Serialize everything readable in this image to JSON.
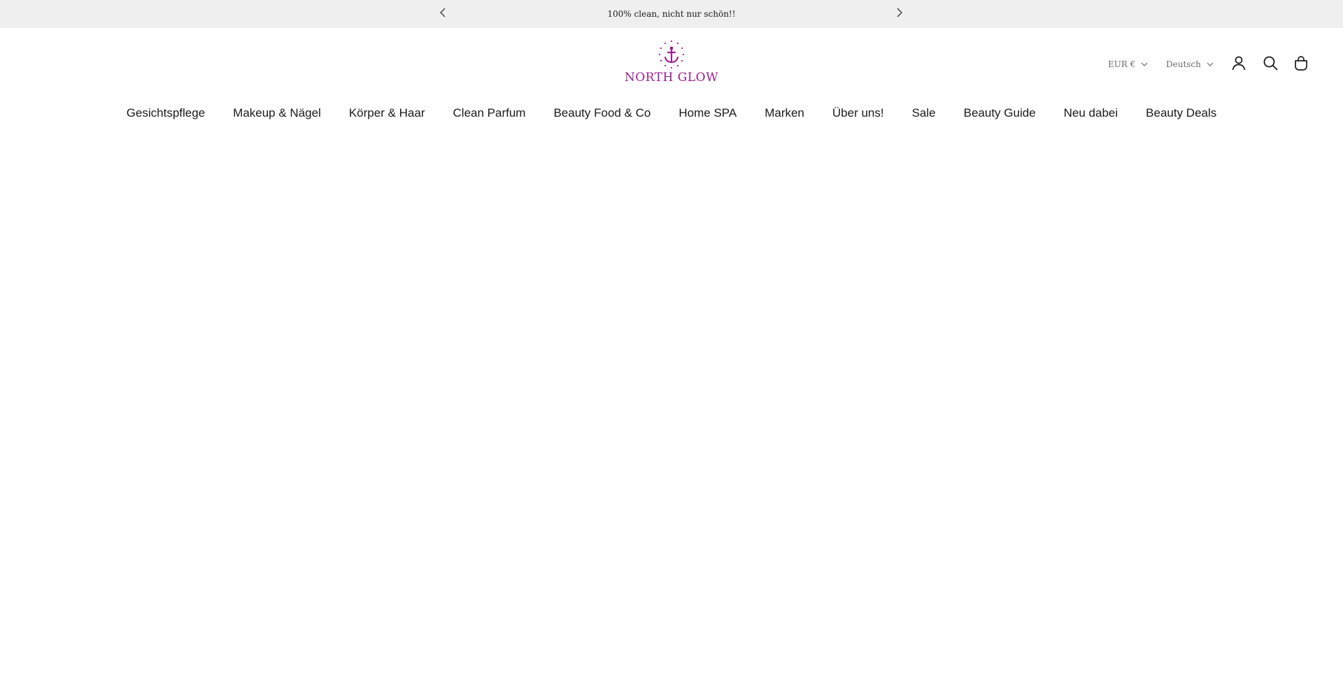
{
  "announcement": {
    "text": "100% clean, nicht nur schön!!",
    "prev_icon": "chevron-left-icon",
    "next_icon": "chevron-right-icon",
    "background": "#efefef"
  },
  "header": {
    "logo": {
      "text": "NORTH GLOW",
      "icon": "anchor-icon",
      "color": "#9b1f8f"
    },
    "currency": {
      "selected": "EUR €"
    },
    "language": {
      "selected": "Deutsch"
    },
    "icons": {
      "account": "user-icon",
      "search": "search-icon",
      "cart": "shopping-bag-icon"
    }
  },
  "nav": {
    "items": [
      {
        "label": "Gesichtspflege"
      },
      {
        "label": "Makeup & Nägel"
      },
      {
        "label": "Körper & Haar"
      },
      {
        "label": "Clean Parfum"
      },
      {
        "label": "Beauty Food & Co"
      },
      {
        "label": "Home SPA"
      },
      {
        "label": "Marken"
      },
      {
        "label": "Über uns!"
      },
      {
        "label": "Sale"
      },
      {
        "label": "Beauty Guide"
      },
      {
        "label": "Neu dabei"
      },
      {
        "label": "Beauty Deals"
      }
    ]
  }
}
